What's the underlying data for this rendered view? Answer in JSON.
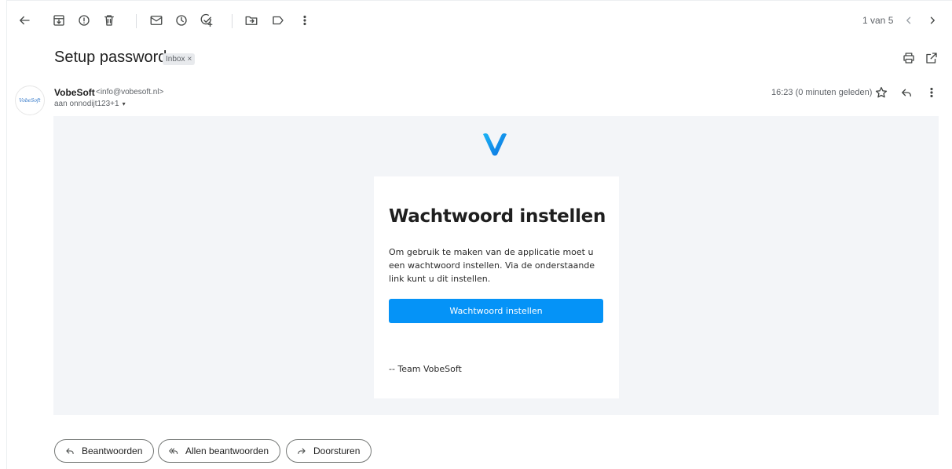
{
  "toolbar": {
    "items": [
      "back",
      "archive",
      "report-spam",
      "delete",
      "mark-unread",
      "snooze",
      "add-to-tasks",
      "move-to",
      "labels",
      "more"
    ]
  },
  "pager": {
    "text": "1 van 5"
  },
  "email": {
    "subject": "Setup password",
    "label_badge": "Inbox",
    "label_badge_close": "×",
    "sender": {
      "name": "VobeSoft",
      "email": "<info@vobesoft.nl>",
      "avatar_text": "VobeSoft",
      "recipient": "aan onnodijt123+1",
      "recipient_caret": "▾"
    },
    "timestamp": "16:23 (0 minuten geleden)"
  },
  "content": {
    "logo_color": "#1a9bf0",
    "title": "Wachtwoord instellen",
    "body": "Om gebruik te maken van de applicatie moet u een wachtwoord instellen. Via de onderstaande link kunt u dit instellen.",
    "button_label": "Wachtwoord instellen",
    "button_color": "#0593f7",
    "signature": "-- Team VobeSoft"
  },
  "actions": {
    "reply": "Beantwoorden",
    "reply_all": "Allen beantwoorden",
    "forward": "Doorsturen"
  }
}
